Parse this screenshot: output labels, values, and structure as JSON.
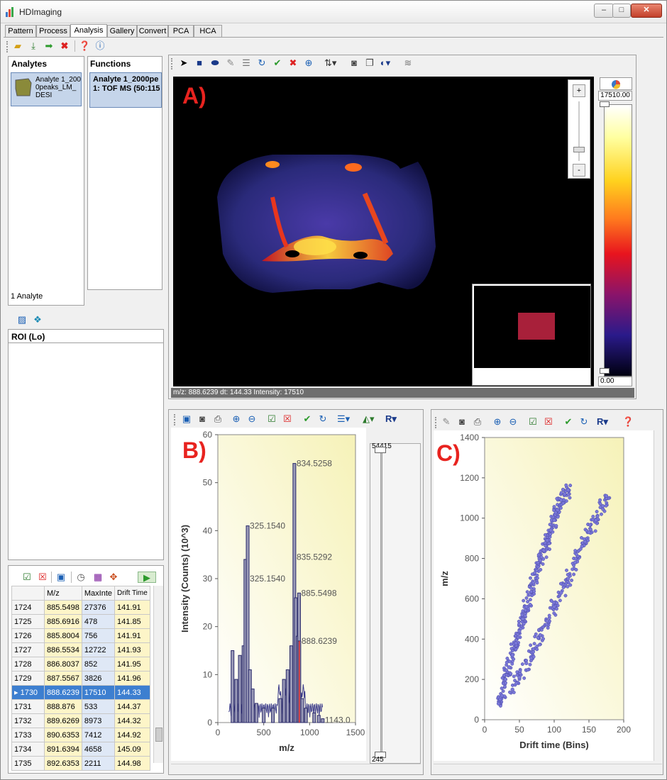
{
  "app": {
    "title": "HDImaging"
  },
  "window_controls": {
    "minimize": "–",
    "maximize": "□",
    "close": "✕"
  },
  "tabs": [
    {
      "label": "Pattern"
    },
    {
      "label": "Process"
    },
    {
      "label": "Analysis"
    },
    {
      "label": "Gallery"
    },
    {
      "label": "Convert"
    },
    {
      "label": "PCA"
    },
    {
      "label": "HCA"
    }
  ],
  "analytes": {
    "header": "Analytes",
    "item_label": "Analyte 1_2000peaks_LM_DESI",
    "count": "1 Analyte"
  },
  "functions": {
    "header": "Functions",
    "item_title": "Analyte 1_2000pe",
    "item_sub": "1: TOF MS (50:115"
  },
  "roi": {
    "header": "ROI (Lo)"
  },
  "image": {
    "panel_label": "A)",
    "colorbar_max": "17510.00",
    "colorbar_min": "0.00",
    "zoom_plus": "+",
    "zoom_minus": "-",
    "status": "m/z: 888.6239 dt: 144.33 Intensity: 17510"
  },
  "spectrum": {
    "panel_label": "B)",
    "slider_top": "54415",
    "slider_bottom": "245"
  },
  "drift": {
    "panel_label": "C)"
  },
  "table": {
    "columns": [
      "M/z",
      "MaxInte",
      "Drift Time"
    ],
    "rows": [
      {
        "id": "1724",
        "mz": "885.5498",
        "max": "27376",
        "dt": "141.91"
      },
      {
        "id": "1725",
        "mz": "885.6916",
        "max": "478",
        "dt": "141.85"
      },
      {
        "id": "1726",
        "mz": "885.8004",
        "max": "756",
        "dt": "141.91"
      },
      {
        "id": "1727",
        "mz": "886.5534",
        "max": "12722",
        "dt": "141.93"
      },
      {
        "id": "1728",
        "mz": "886.8037",
        "max": "852",
        "dt": "141.95"
      },
      {
        "id": "1729",
        "mz": "887.5567",
        "max": "3826",
        "dt": "141.96"
      },
      {
        "id": "1730",
        "mz": "888.6239",
        "max": "17510",
        "dt": "144.33"
      },
      {
        "id": "1731",
        "mz": "888.876",
        "max": "533",
        "dt": "144.37"
      },
      {
        "id": "1732",
        "mz": "889.6269",
        "max": "8973",
        "dt": "144.32"
      },
      {
        "id": "1733",
        "mz": "890.6353",
        "max": "7412",
        "dt": "144.92"
      },
      {
        "id": "1734",
        "mz": "891.6394",
        "max": "4658",
        "dt": "145.09"
      },
      {
        "id": "1735",
        "mz": "892.6353",
        "max": "2211",
        "dt": "144.98"
      }
    ],
    "selected_index": 6
  },
  "chart_data": [
    {
      "type": "bar",
      "xlabel": "m/z",
      "ylabel": "Intensity (Counts) (10^3)",
      "xlim": [
        0,
        1500
      ],
      "ylim": [
        0,
        60
      ],
      "xticks": [
        "0",
        "500",
        "1000",
        "1500"
      ],
      "yticks": [
        "0",
        "10",
        "20",
        "30",
        "40",
        "50",
        "60"
      ],
      "peaks": [
        {
          "x": 160,
          "y": 15
        },
        {
          "x": 200,
          "y": 9
        },
        {
          "x": 240,
          "y": 14
        },
        {
          "x": 280,
          "y": 16
        },
        {
          "x": 300,
          "y": 34
        },
        {
          "x": 325,
          "y": 41
        },
        {
          "x": 350,
          "y": 11
        },
        {
          "x": 380,
          "y": 7
        },
        {
          "x": 420,
          "y": 4
        },
        {
          "x": 500,
          "y": 3
        },
        {
          "x": 600,
          "y": 3
        },
        {
          "x": 680,
          "y": 5
        },
        {
          "x": 720,
          "y": 9
        },
        {
          "x": 760,
          "y": 11
        },
        {
          "x": 800,
          "y": 16
        },
        {
          "x": 834,
          "y": 54
        },
        {
          "x": 850,
          "y": 26
        },
        {
          "x": 870,
          "y": 18
        },
        {
          "x": 885,
          "y": 27
        },
        {
          "x": 888,
          "y": 17
        },
        {
          "x": 920,
          "y": 5
        },
        {
          "x": 960,
          "y": 3
        },
        {
          "x": 1050,
          "y": 2
        },
        {
          "x": 1100,
          "y": 1.5
        },
        {
          "x": 1143,
          "y": 0.8
        }
      ],
      "annotations": [
        {
          "x": 834,
          "y": 54,
          "text": "834.5258"
        },
        {
          "x": 325,
          "y": 41,
          "text": "325.1540"
        },
        {
          "x": 835,
          "y": 34.5,
          "text": "835.5292"
        },
        {
          "x": 325,
          "y": 30,
          "text": "325.1540"
        },
        {
          "x": 885,
          "y": 27,
          "text": "885.5498"
        },
        {
          "x": 888,
          "y": 17,
          "text": "888.6239"
        },
        {
          "x": 1143,
          "y": 0.5,
          "text": "1143.0"
        }
      ]
    },
    {
      "type": "scatter",
      "xlabel": "Drift time (Bins)",
      "ylabel": "m/z",
      "xlim": [
        0,
        200
      ],
      "ylim": [
        0,
        1400
      ],
      "xticks": [
        "0",
        "50",
        "100",
        "150",
        "200"
      ],
      "yticks": [
        "0",
        "200",
        "400",
        "600",
        "800",
        "1000",
        "1200",
        "1400"
      ],
      "series": [
        {
          "points": [
            [
              20,
              80
            ],
            [
              25,
              120
            ],
            [
              30,
              200
            ],
            [
              35,
              260
            ],
            [
              40,
              320
            ],
            [
              45,
              380
            ],
            [
              50,
              440
            ],
            [
              55,
              500
            ],
            [
              60,
              560
            ],
            [
              65,
              620
            ],
            [
              70,
              680
            ],
            [
              75,
              740
            ],
            [
              80,
              790
            ],
            [
              85,
              840
            ],
            [
              90,
              890
            ],
            [
              95,
              940
            ],
            [
              100,
              990
            ],
            [
              105,
              1040
            ],
            [
              110,
              1090
            ],
            [
              115,
              1120
            ],
            [
              120,
              1140
            ]
          ]
        },
        {
          "points": [
            [
              40,
              150
            ],
            [
              50,
              210
            ],
            [
              60,
              280
            ],
            [
              70,
              350
            ],
            [
              80,
              420
            ],
            [
              90,
              490
            ],
            [
              100,
              560
            ],
            [
              110,
              630
            ],
            [
              120,
              700
            ],
            [
              130,
              780
            ],
            [
              140,
              860
            ],
            [
              150,
              930
            ],
            [
              160,
              990
            ],
            [
              170,
              1060
            ],
            [
              175,
              1110
            ]
          ]
        }
      ]
    }
  ]
}
